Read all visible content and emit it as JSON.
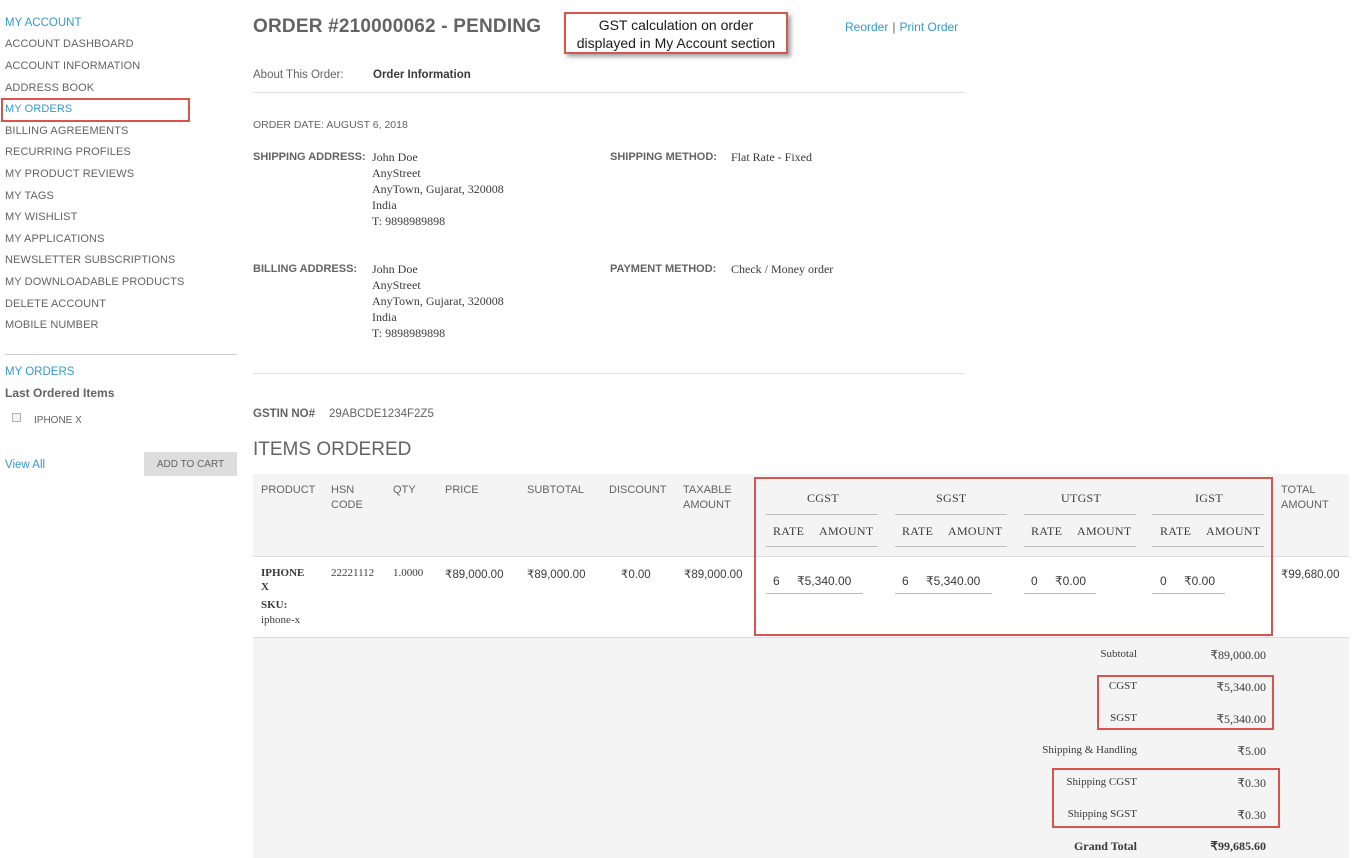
{
  "sidebar": {
    "title": "MY ACCOUNT",
    "items": [
      "ACCOUNT DASHBOARD",
      "ACCOUNT INFORMATION",
      "ADDRESS BOOK",
      "MY ORDERS",
      "BILLING AGREEMENTS",
      "RECURRING PROFILES",
      "MY PRODUCT REVIEWS",
      "MY TAGS",
      "MY WISHLIST",
      "MY APPLICATIONS",
      "NEWSLETTER SUBSCRIPTIONS",
      "MY DOWNLOADABLE PRODUCTS",
      "DELETE ACCOUNT",
      "MOBILE NUMBER"
    ],
    "orders_title": "MY ORDERS",
    "last_ordered_label": "Last Ordered Items",
    "last_product": "IPHONE X",
    "view_all": "View All",
    "add_to_cart": "ADD TO CART"
  },
  "header": {
    "title": "ORDER #210000062 - PENDING",
    "callout_line1": "GST calculation on order",
    "callout_line2": "displayed in My Account section",
    "reorder": "Reorder",
    "separator": "|",
    "print_order": "Print Order"
  },
  "about": {
    "label": "About This Order:",
    "tab": "Order Information"
  },
  "order": {
    "date": "ORDER DATE: AUGUST 6, 2018",
    "shipping_address_label": "SHIPPING ADDRESS:",
    "shipping_address": [
      "John Doe",
      "AnyStreet",
      "AnyTown, Gujarat, 320008",
      "India",
      "T: 9898989898"
    ],
    "shipping_method_label": "SHIPPING METHOD:",
    "shipping_method": "Flat Rate - Fixed",
    "billing_address_label": "BILLING ADDRESS:",
    "billing_address": [
      "John Doe",
      "AnyStreet",
      "AnyTown, Gujarat, 320008",
      "India",
      "T: 9898989898"
    ],
    "payment_method_label": "PAYMENT METHOD:",
    "payment_method": "Check / Money order",
    "gstin_label": "GSTIN NO#",
    "gstin_value": "29ABCDE1234F2Z5"
  },
  "items": {
    "title": "ITEMS ORDERED",
    "headers": {
      "product": "PRODUCT",
      "hsn_1": "HSN",
      "hsn_2": "CODE",
      "qty": "QTY",
      "price": "PRICE",
      "subtotal": "SUBTOTAL",
      "discount": "DISCOUNT",
      "taxable_1": "TAXABLE",
      "taxable_2": "AMOUNT",
      "cgst": "CGST",
      "sgst": "SGST",
      "utgst": "UTGST",
      "igst": "IGST",
      "rate": "RATE",
      "amount": "AMOUNT",
      "total_1": "TOTAL",
      "total_2": "AMOUNT"
    },
    "row": {
      "product_1": "IPHONE",
      "product_2": "X",
      "sku_label": "SKU:",
      "sku": "iphone-x",
      "hsn": "22221112",
      "qty": "1.0000",
      "price": "₹89,000.00",
      "subtotal": "₹89,000.00",
      "discount": "₹0.00",
      "taxable": "₹89,000.00",
      "cgst_rate": "6",
      "cgst_amount": "₹5,340.00",
      "sgst_rate": "6",
      "sgst_amount": "₹5,340.00",
      "utgst_rate": "0",
      "utgst_amount": "₹0.00",
      "igst_rate": "0",
      "igst_amount": "₹0.00",
      "total": "₹99,680.00"
    }
  },
  "totals": {
    "subtotal_label": "Subtotal",
    "subtotal": "₹89,000.00",
    "cgst_label": "CGST",
    "cgst": "₹5,340.00",
    "sgst_label": "SGST",
    "sgst": "₹5,340.00",
    "shipping_label": "Shipping & Handling",
    "shipping": "₹5.00",
    "shipping_cgst_label": "Shipping CGST",
    "shipping_cgst": "₹0.30",
    "shipping_sgst_label": "Shipping SGST",
    "shipping_sgst": "₹0.30",
    "grand_label": "Grand Total",
    "grand": "₹99,685.60"
  },
  "colors": {
    "accent": "#3399cc",
    "highlight": "#d9534f",
    "text": "#636363"
  }
}
